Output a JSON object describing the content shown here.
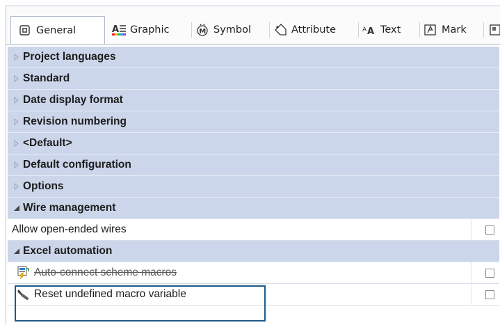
{
  "tabs": [
    {
      "label": "General",
      "icon": "general-settings-icon"
    },
    {
      "label": "Graphic",
      "icon": "graphic-icon"
    },
    {
      "label": "Symbol",
      "icon": "symbol-icon"
    },
    {
      "label": "Attribute",
      "icon": "attribute-tag-icon"
    },
    {
      "label": "Text",
      "icon": "text-icon"
    },
    {
      "label": "Mark",
      "icon": "mark-icon"
    }
  ],
  "active_tab": "General",
  "categories_collapsed": [
    "Project languages",
    "Standard",
    "Date display format",
    "Revision numbering",
    "<Default>",
    "Default configuration",
    "Options"
  ],
  "wire_management": {
    "label": "Wire management",
    "items": [
      {
        "label": "Allow open-ended wires",
        "checked": false
      }
    ]
  },
  "excel_automation": {
    "label": "Excel automation",
    "items": [
      {
        "label": "Auto-connect scheme macros",
        "checked": false,
        "icon": "auto-connect-macro-icon"
      },
      {
        "label": "Reset undefined macro variable",
        "checked": false,
        "icon": "reset-brush-icon"
      }
    ]
  },
  "colors": {
    "category_bg": "#ccd6ea",
    "highlight_border": "#1f5b8a"
  }
}
